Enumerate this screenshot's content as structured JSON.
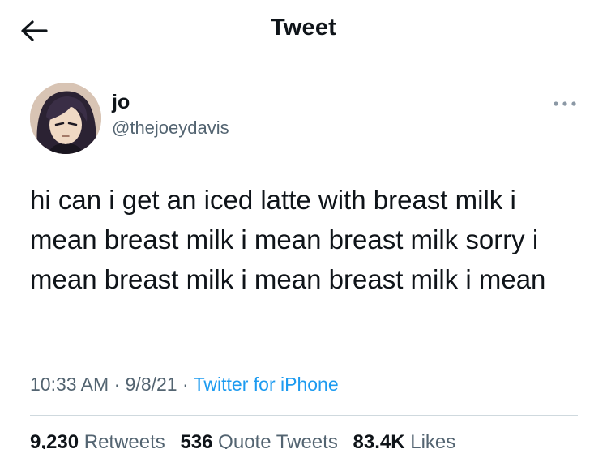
{
  "header": {
    "title": "Tweet",
    "back_icon": "arrow-left-icon"
  },
  "author": {
    "display_name": "jo",
    "handle": "@thejoeydavis",
    "avatar_icon": "avatar"
  },
  "more_icon": "ellipsis-icon",
  "tweet": {
    "text": "hi can i get an iced latte with breast milk i mean breast milk i mean breast milk sorry i mean breast milk i mean breast milk i mean",
    "time": "10:33 AM",
    "date": "9/8/21",
    "separator": "·",
    "source": "Twitter for iPhone"
  },
  "stats": {
    "retweets_count": "9,230",
    "retweets_label": "Retweets",
    "quotes_count": "536",
    "quotes_label": "Quote Tweets",
    "likes_count": "83.4K",
    "likes_label": "Likes"
  },
  "colors": {
    "text": "#0f1419",
    "secondary": "#536471",
    "link": "#1d9bf0",
    "divider": "#cfd9de"
  }
}
